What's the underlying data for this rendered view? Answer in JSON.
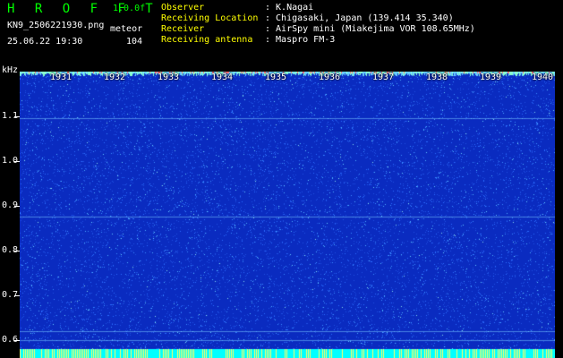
{
  "header": {
    "brand": "H R O F F T",
    "version": "1.0.0f",
    "filename": "KN9_2506221930.png",
    "datetime": "25.06.22 19:30",
    "meteor_label": "meteor",
    "meteor_count": "104",
    "info": [
      {
        "label": "Observer",
        "value": ": K.Nagai"
      },
      {
        "label": "Receiving Location",
        "value": ": Chigasaki, Japan (139.414 35.340)"
      },
      {
        "label": "Receiver",
        "value": ": AirSpy mini (Miakejima VOR 108.65MHz)"
      },
      {
        "label": "Receiving antenna",
        "value": ": Maspro FM-3"
      }
    ]
  },
  "axis": {
    "unit": "kHz",
    "y_ticks": [
      "1.1",
      "1.0",
      "0.9",
      "0.8",
      "0.7",
      "0.6"
    ],
    "x_ticks": [
      "1931",
      "1932",
      "1933",
      "1934",
      "1935",
      "1936",
      "1937",
      "1938",
      "1939",
      "1940"
    ]
  },
  "colors": {
    "background": "#0a2bc0",
    "noise": "#2b6bff",
    "signal": "#00ffff",
    "brand": "#00ff00",
    "label_yellow": "#ffff00"
  }
}
